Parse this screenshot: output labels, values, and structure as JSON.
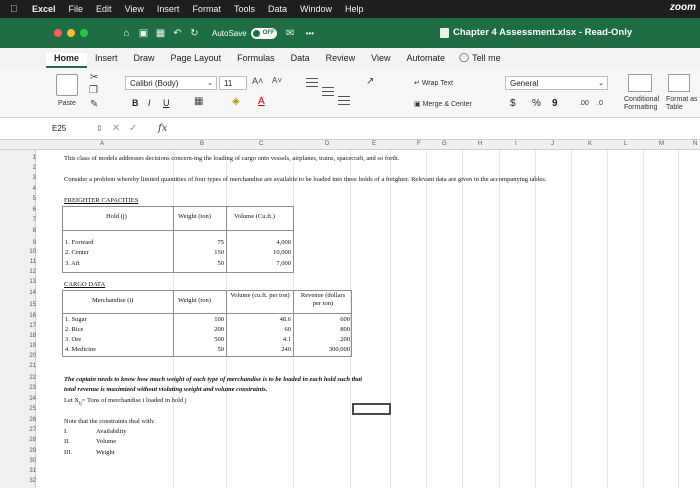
{
  "menubar": {
    "app": "Excel",
    "items": [
      "File",
      "Edit",
      "View",
      "Insert",
      "Format",
      "Tools",
      "Data",
      "Window",
      "Help"
    ],
    "right": "zoom"
  },
  "titlebar": {
    "autosave_label": "AutoSave",
    "autosave_state": "OFF",
    "more": "•••",
    "doc_title": "Chapter 4 Assessment.xlsx - Read-Only"
  },
  "tabs": {
    "items": [
      "Home",
      "Insert",
      "Draw",
      "Page Layout",
      "Formulas",
      "Data",
      "Review",
      "View",
      "Automate"
    ],
    "active": "Home",
    "tell_me": "Tell me"
  },
  "ribbon": {
    "paste": "Paste",
    "font_name": "Calibri (Body)",
    "font_size": "11",
    "grow": "A˄",
    "shrink": "A˅",
    "bold": "B",
    "italic": "I",
    "underline": "U",
    "wrap": "Wrap Text",
    "merge": "Merge & Center",
    "number_format": "General",
    "currency": "$",
    "percent": "%",
    "comma": "9",
    "inc_dec": ".00",
    "dec_dec": ".0",
    "conditional": "Conditional Formatting",
    "format_table": "Format as Table"
  },
  "formula": {
    "cell_ref": "E25",
    "fx": "fx",
    "value": ""
  },
  "columns": [
    "A",
    "B",
    "C",
    "D",
    "E",
    "F",
    "G",
    "H",
    "I",
    "J",
    "K",
    "L",
    "M",
    "N"
  ],
  "rows": [
    "1",
    "2",
    "3",
    "4",
    "5",
    "6",
    "7",
    "8",
    "9",
    "10",
    "11",
    "12",
    "13",
    "14",
    "15",
    "16",
    "17",
    "18",
    "19",
    "20",
    "21",
    "22",
    "23",
    "24",
    "25",
    "26",
    "27",
    "28",
    "29",
    "30",
    "31",
    "32"
  ],
  "sheet": {
    "r1": "This class of models addresses decisions concern-ing the loading of cargo onto vessels, airplanes, trains, spacecraft, and so forth.",
    "r3": "Consider a problem whereby limited quantities of four types of merchandise are available to be loaded into three holds of a freighter. Relevant data are given in the accompanying tables.",
    "freight_title": "FREIGHTER CAPACITIES",
    "freight_headers": [
      "Hold (j)",
      "Weight (ton)",
      "Volume (Cu.ft.)"
    ],
    "freight_rows": [
      {
        "hold": "1. Forward",
        "weight": "75",
        "volume": "4,000"
      },
      {
        "hold": "2. Center",
        "weight": "150",
        "volume": "10,000"
      },
      {
        "hold": "3. Aft",
        "weight": "50",
        "volume": "7,000"
      }
    ],
    "cargo_title": "CARGO DATA",
    "cargo_headers": [
      "Merchandise (i)",
      "Weight (ton)",
      "Volume (cu.ft. per ton)",
      "Revenue (dollars per ton)"
    ],
    "cargo_rows": [
      {
        "item": "1. Sugar",
        "weight": "100",
        "volume": "48.6",
        "revenue": "600"
      },
      {
        "item": "2. Rice",
        "weight": "200",
        "volume": "60",
        "revenue": "800"
      },
      {
        "item": "3. Ore",
        "weight": "500",
        "volume": "4.1",
        "revenue": "200"
      },
      {
        "item": "4. Medicine",
        "weight": "50",
        "volume": "240",
        "revenue": "300,000"
      }
    ],
    "r22": "The captain needs to know how much weight of each type of merchandise is to be loaded in each hold such that",
    "r23": "total revenue is maximized without violating weight and volume constraints.",
    "r24": "Let X",
    "r24_sub": "ij",
    "r24_rest": "= Tons of merchandise i loaded in hold j",
    "r26": "Note that the constraints deal with:",
    "constraints": [
      {
        "num": "I.",
        "label": "Availability"
      },
      {
        "num": "II.",
        "label": "Volume"
      },
      {
        "num": "III.",
        "label": "Weight"
      }
    ]
  },
  "colors": {
    "excel_green": "#1f6e43",
    "menubar": "#1e1e1e"
  }
}
